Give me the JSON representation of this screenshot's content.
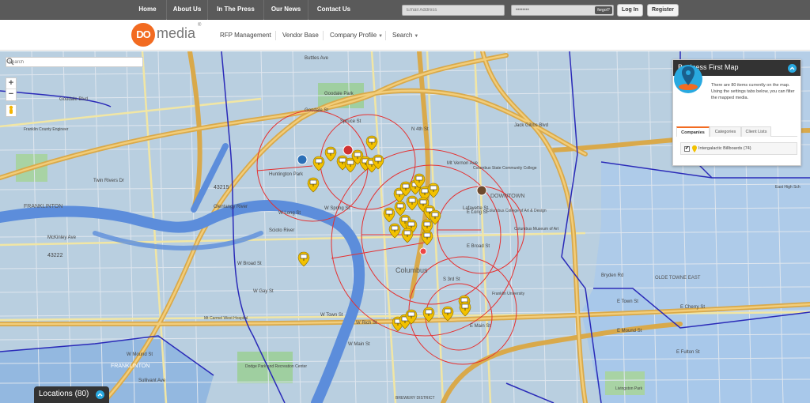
{
  "topbar": {
    "nav": [
      "Home",
      "About Us",
      "In The Press",
      "Our News",
      "Contact Us"
    ],
    "email_placeholder": "Email Address",
    "password_value": "••••••••",
    "forgot_label": "forgot?",
    "login_label": "Log In",
    "register_label": "Register"
  },
  "header": {
    "logo_mark": "DO",
    "logo_word": "media",
    "logo_reg": "®",
    "nav": {
      "rfp": "RFP Management",
      "vendor": "Vendor Base",
      "company": "Company Profile",
      "search": "Search"
    }
  },
  "map": {
    "search_placeholder": "Search",
    "zoom_in": "+",
    "zoom_out": "−",
    "street_labels": {
      "goodale_park": "Goodale Park",
      "goodale_blvd": "Goodale Blvd",
      "spruce": "Spruce St",
      "huntington": "Huntington Park",
      "olentangy": "Olentangy River",
      "scioto": "Scioto River",
      "w_long": "W Long St",
      "w_spring": "W Spring St",
      "e_broad": "E Broad St",
      "columbus": "Columbus",
      "downtown": "DOWNTOWN",
      "franklinton": "FRANKLINTON",
      "w_town": "W Town St",
      "w_rich": "W Rich St",
      "w_main": "W Main St",
      "e_main": "E Main St",
      "mckinley": "McKinley Ave",
      "twin_rivers": "Twin Rivers Dr",
      "zip_43215": "43215",
      "zip_43222": "43222",
      "jack_gibbs": "Jack Gibbs Blvd",
      "cscc": "Columbus State Community College",
      "ccad": "Columbus College of Art & Design",
      "museum": "Columbus Museum of Art",
      "dodge": "Dodge Park and Recreation Center",
      "mt_carmel": "Mt Carmel West Hospital",
      "franklin_univ": "Franklin University",
      "brewery": "BREWERY DISTRICT",
      "olde_town": "OLDE TOWNE EAST",
      "east_high": "East High Sch",
      "livingston": "Livingston Park",
      "franklin_county": "Franklin County Engineer",
      "i70": "I-70",
      "e_fulton": "E Fulton St",
      "e_cherry": "E Cherry St",
      "bryden": "Bryden Rd",
      "e_town": "E Town St",
      "s_3rd": "S 3rd St",
      "n_4th": "N 4th St",
      "mt_vernon": "Mt Vernon Ave",
      "e_long": "E Long St",
      "sullivant": "Sullivant Ave",
      "mound": "W Mound St",
      "gay": "W Gay St",
      "broad_w": "W Broad St",
      "goodale_st": "Goodale St",
      "buttles": "Buttles Ave",
      "e_mound": "E Mound St",
      "lafayette": "Lafayette St"
    }
  },
  "panel": {
    "title": "Business First Map",
    "text": "There are 80 items currently on the map. Using the settings tabs below, you can filter the mapped media.",
    "tabs": [
      "Companies",
      "Categories",
      "Client Lists"
    ],
    "item_label": "Intergalactic Billboards (74)",
    "check": "✔"
  },
  "locations": {
    "label": "Locations (80)"
  },
  "colors": {
    "accent": "#f26b21",
    "toggle": "#29a9e0",
    "map_bg": "#b9cfe0",
    "boundary": "#2a2ab8",
    "circles": "#e53030",
    "highway": "#d9a94a"
  }
}
